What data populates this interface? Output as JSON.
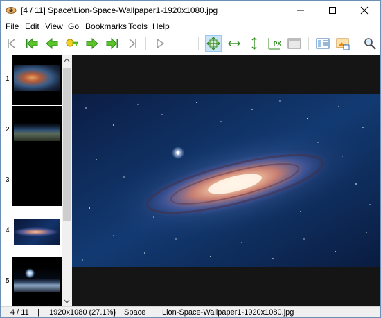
{
  "window": {
    "title": "[4 / 11]  Space\\Lion-Space-Wallpaper1-1920x1080.jpg",
    "app_icon": "eye-icon"
  },
  "menu": {
    "items": [
      "File",
      "Edit",
      "View",
      "Go",
      "Bookmarks",
      "Tools",
      "Help"
    ]
  },
  "toolbar": {
    "buttons": [
      {
        "name": "first-image",
        "icon": "skip-first-icon"
      },
      {
        "name": "jump-back",
        "icon": "double-arrow-left-icon"
      },
      {
        "name": "previous",
        "icon": "arrow-left-icon"
      },
      {
        "name": "go-to",
        "icon": "key-icon"
      },
      {
        "name": "next",
        "icon": "arrow-right-icon"
      },
      {
        "name": "jump-forward",
        "icon": "double-arrow-right-icon"
      },
      {
        "name": "last-image",
        "icon": "skip-last-icon"
      },
      {
        "name": "slideshow",
        "icon": "play-icon"
      },
      {
        "name": "fit-to-window",
        "icon": "fit-both-icon",
        "active": true
      },
      {
        "name": "fit-width",
        "icon": "fit-width-icon"
      },
      {
        "name": "fit-height",
        "icon": "fit-height-icon"
      },
      {
        "name": "original-size",
        "icon": "pixel-size-icon"
      },
      {
        "name": "full-screen",
        "icon": "fullscreen-icon"
      },
      {
        "name": "thumbnails",
        "icon": "thumbnails-icon"
      },
      {
        "name": "image-info",
        "icon": "image-info-icon"
      },
      {
        "name": "search",
        "icon": "search-icon"
      }
    ]
  },
  "thumbnails": [
    {
      "index": "1",
      "subject": "nebula"
    },
    {
      "index": "2",
      "subject": "earth-horizon"
    },
    {
      "index": "3",
      "subject": "dark"
    },
    {
      "index": "4",
      "subject": "galaxy",
      "selected": true
    },
    {
      "index": "5",
      "subject": "planet-rise"
    }
  ],
  "status": {
    "position": "4 / 11",
    "dimensions": "1920x1080 (27.1%)",
    "folder": "Space",
    "filename": "Lion-Space-Wallpaper1-1920x1080.jpg",
    "sep1": "|",
    "sep2": "|",
    "sep3": "|"
  },
  "colors": {
    "viewer_bg": "#151515",
    "active_button_bg": "#cce4f7",
    "window_border": "#6b8fb5"
  }
}
